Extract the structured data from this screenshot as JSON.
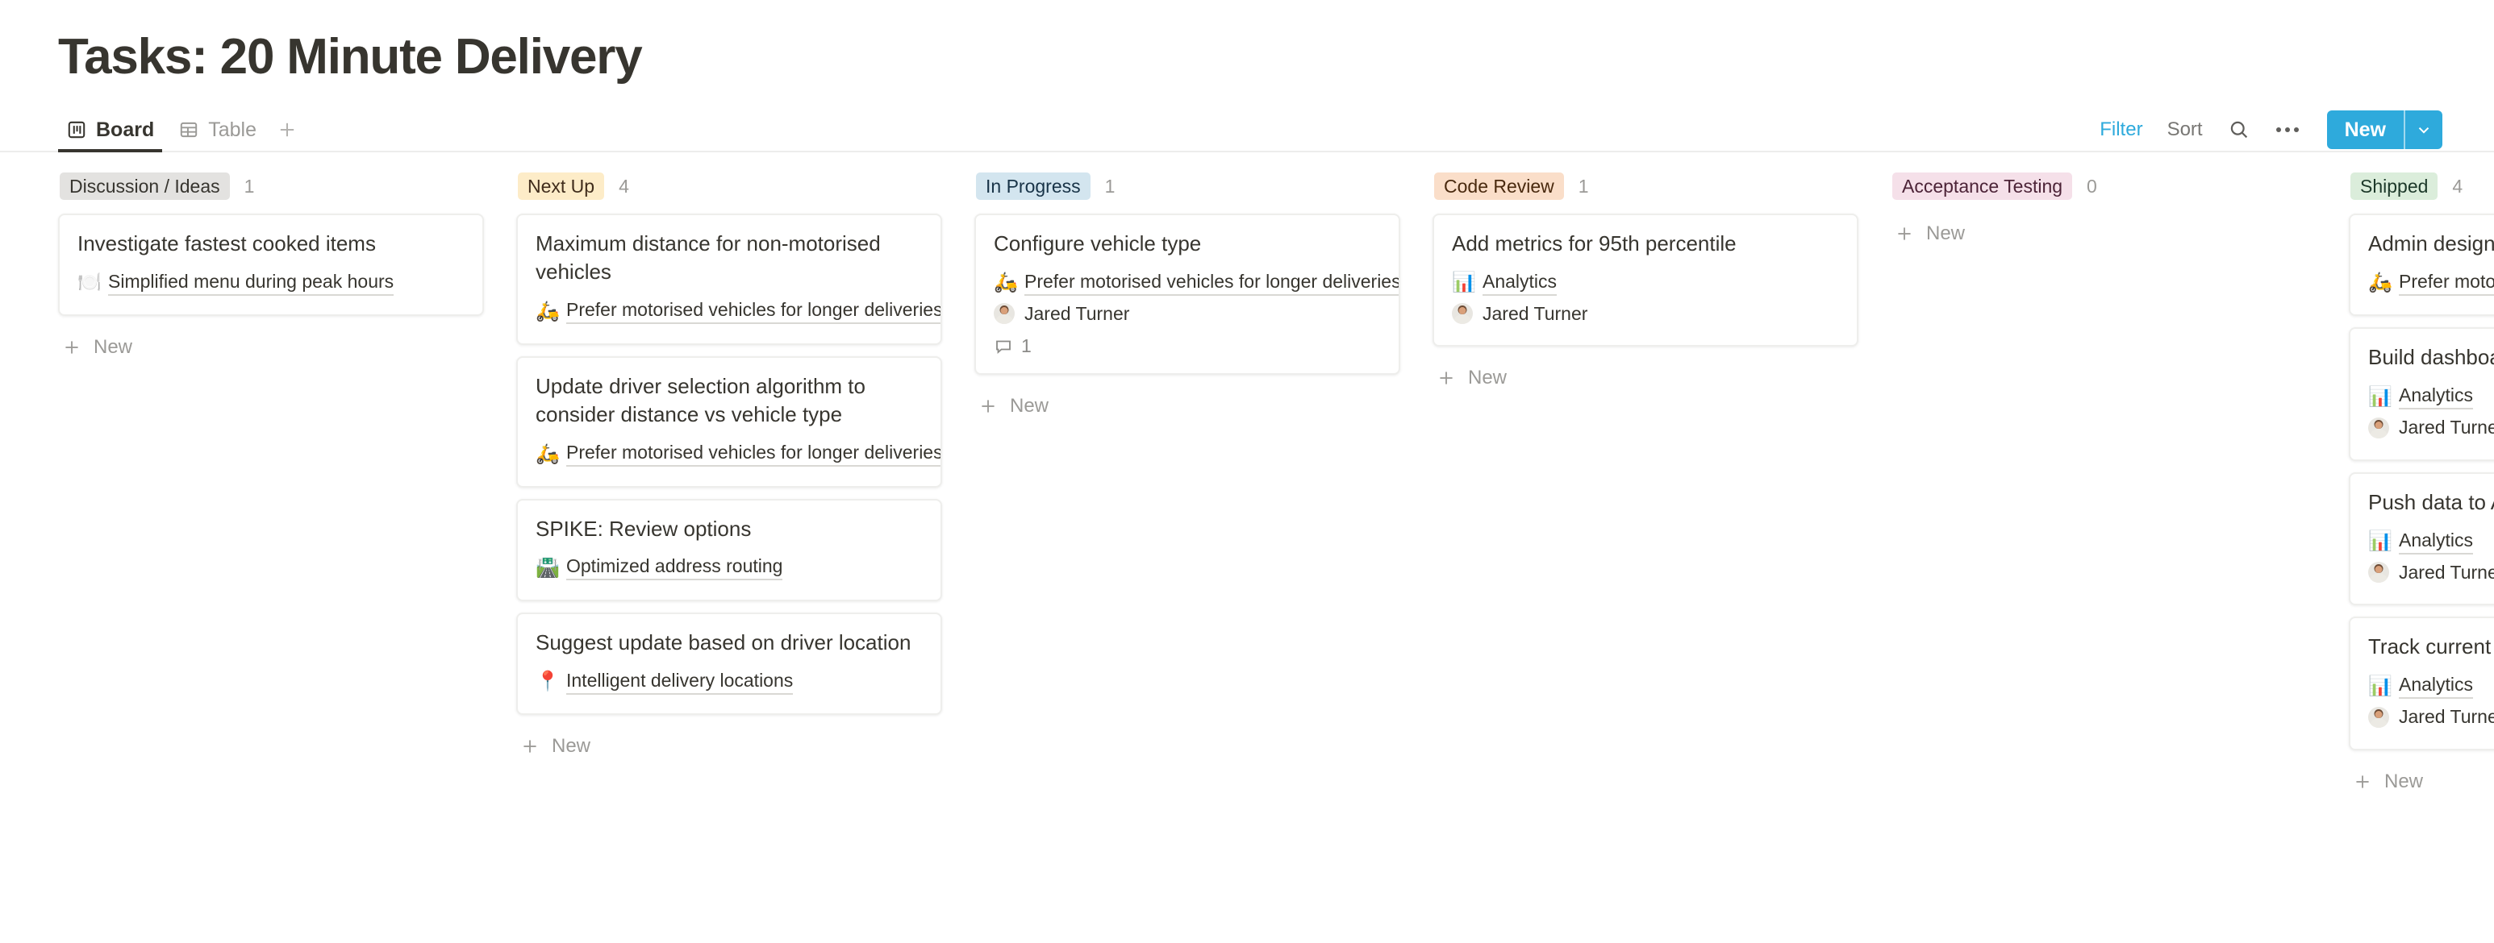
{
  "header": {
    "title": "Tasks: 20 Minute Delivery"
  },
  "view_tabs": [
    {
      "label": "Board",
      "icon": "board-icon",
      "active": true
    },
    {
      "label": "Table",
      "icon": "table-icon",
      "active": false
    }
  ],
  "toolbar": {
    "filter_label": "Filter",
    "sort_label": "Sort",
    "search_icon": "search-icon",
    "more_icon": "more-options-icon",
    "new_label": "New",
    "new_caret_icon": "chevron-down-icon",
    "accent_color": "#2eaadc"
  },
  "board": {
    "new_label": "New",
    "columns": [
      {
        "name": "Discussion / Ideas",
        "count": "1",
        "pill_bg": "#e3e2e0",
        "pill_fg": "#37352f",
        "cards": [
          {
            "title": "Investigate fastest cooked items",
            "relation": {
              "emoji": "🍽️",
              "text": "Simplified menu during peak hours"
            },
            "person": null,
            "comments": null
          }
        ]
      },
      {
        "name": "Next Up",
        "count": "4",
        "pill_bg": "#fdecc8",
        "pill_fg": "#402c1b",
        "cards": [
          {
            "title": "Maximum distance for non-motorised vehicles",
            "relation": {
              "emoji": "🛵",
              "text": "Prefer motorised vehicles for longer deliveries"
            },
            "person": null,
            "comments": null
          },
          {
            "title": "Update driver selection algorithm to consider distance vs vehicle type",
            "relation": {
              "emoji": "🛵",
              "text": "Prefer motorised vehicles for longer deliveries"
            },
            "person": null,
            "comments": null
          },
          {
            "title": "SPIKE: Review options",
            "relation": {
              "emoji": "🛣️",
              "text": "Optimized address routing"
            },
            "person": null,
            "comments": null
          },
          {
            "title": "Suggest update based on driver location",
            "relation": {
              "emoji": "📍",
              "text": "Intelligent delivery locations"
            },
            "person": null,
            "comments": null
          }
        ]
      },
      {
        "name": "In Progress",
        "count": "1",
        "pill_bg": "#d3e5ef",
        "pill_fg": "#183347",
        "cards": [
          {
            "title": "Configure vehicle type",
            "relation": {
              "emoji": "🛵",
              "text": "Prefer motorised vehicles for longer deliveries"
            },
            "person": "Jared Turner",
            "comments": "1"
          }
        ]
      },
      {
        "name": "Code Review",
        "count": "1",
        "pill_bg": "#fadec9",
        "pill_fg": "#49290e",
        "cards": [
          {
            "title": "Add metrics for 95th percentile",
            "relation": {
              "emoji": "📊",
              "text": "Analytics"
            },
            "person": "Jared Turner",
            "comments": null
          }
        ]
      },
      {
        "name": "Acceptance Testing",
        "count": "0",
        "pill_bg": "#f5e0e9",
        "pill_fg": "#4c2337",
        "cards": []
      },
      {
        "name": "Shipped",
        "count": "4",
        "pill_bg": "#dbeddb",
        "pill_fg": "#1c3829",
        "cards": [
          {
            "title": "Admin designs",
            "relation": {
              "emoji": "🛵",
              "text": "Prefer motorised vehicles for longer deliveries"
            },
            "person": null,
            "comments": null
          },
          {
            "title": "Build dashboards",
            "relation": {
              "emoji": "📊",
              "text": "Analytics"
            },
            "person": "Jared Turner",
            "comments": null
          },
          {
            "title": "Push data to Analytics",
            "relation": {
              "emoji": "📊",
              "text": "Analytics"
            },
            "person": "Jared Turner",
            "comments": null
          },
          {
            "title": "Track current delivery times",
            "relation": {
              "emoji": "📊",
              "text": "Analytics"
            },
            "person": "Jared Turner",
            "comments": null
          }
        ]
      }
    ]
  }
}
